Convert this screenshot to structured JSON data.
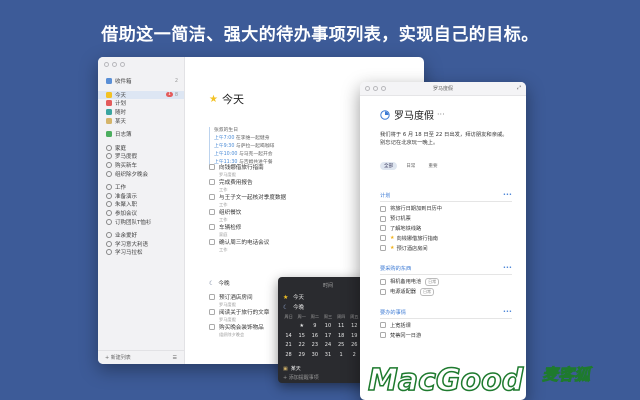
{
  "headline": "借助这一简洁、强大的待办事项列表，实现自己的目标。",
  "main_window": {
    "sidebar": {
      "items": [
        {
          "label": "收件箱",
          "count": "2",
          "icon": "inbox-icon",
          "color": "#5a8fd6"
        },
        {
          "label": "今天",
          "badge": "1",
          "count": "8",
          "icon": "star-icon",
          "color": "#f3c224",
          "selected": true
        },
        {
          "label": "计划",
          "count": "",
          "icon": "calendar-icon",
          "color": "#e35b5b"
        },
        {
          "label": "随时",
          "count": "",
          "icon": "layers-icon",
          "color": "#3aa5a0"
        },
        {
          "label": "某天",
          "count": "",
          "icon": "archive-icon",
          "color": "#d5b56a"
        },
        {
          "label": "日志簿",
          "count": "",
          "icon": "logbook-icon",
          "color": "#4cae5f"
        }
      ],
      "groups": [
        {
          "label": "家庭",
          "projects": [
            "罗马度假",
            "购买新车",
            "组织除夕晚会"
          ]
        },
        {
          "label": "工作",
          "projects": [
            "准备演示",
            "朱聚入职",
            "参加会议",
            "订购团队T恤衫"
          ]
        },
        {
          "label": "业余爱好",
          "projects": [
            "学习意大利语",
            "学习马拉松"
          ]
        }
      ],
      "footer_new_list": "+ 新建列表",
      "footer_settings_icon": "sliders-icon"
    },
    "title": "今天",
    "events": [
      {
        "time": "",
        "text": "张叔的生日"
      },
      {
        "time": "上午7:00",
        "text": "在李维一起健身"
      },
      {
        "time": "上午9:30",
        "text": "与萨拉一起喝咖啡"
      },
      {
        "time": "上午10:00",
        "text": "与马克一起开会"
      },
      {
        "time": "上午11:30",
        "text": "与吉姆共进午餐"
      }
    ],
    "tasks": [
      {
        "text": "向钱娜借旅行指南",
        "sub": "罗马度假"
      },
      {
        "text": "完成费用报告",
        "sub": "工作"
      },
      {
        "text": "与王子文一起核对季度数据",
        "sub": "工作"
      },
      {
        "text": "组织餐饮",
        "sub": "工作"
      },
      {
        "text": "车辆检修",
        "sub": "家庭"
      },
      {
        "text": "确认周三的电话会议",
        "sub": "工作"
      }
    ],
    "evening_label": "今晚",
    "evening_tasks": [
      {
        "text": "预订酒店房间",
        "sub": "罗马度假"
      },
      {
        "text": "阅读关于旅行的文章",
        "sub": "罗马度假"
      },
      {
        "text": "购买晚会装饰物品",
        "sub": "组织除夕晚会"
      }
    ]
  },
  "popover": {
    "header": "时间",
    "option_today": "今天",
    "option_evening": "今晚",
    "weekdays": [
      "周日",
      "周一",
      "周二",
      "周三",
      "周四",
      "周五",
      "周六"
    ],
    "weeks": [
      [
        "",
        "",
        "",
        "",
        "",
        "",
        ""
      ],
      [
        "",
        "★",
        "9",
        "10",
        "11",
        "12",
        "13"
      ],
      [
        "14",
        "15",
        "16",
        "17",
        "18",
        "19",
        "20"
      ],
      [
        "21",
        "22",
        "23",
        "24",
        "25",
        "26",
        "27"
      ],
      [
        "28",
        "29",
        "30",
        "31",
        "1",
        "2",
        ">"
      ]
    ],
    "someday": "某天",
    "add_reminder": "+ 添加提醒事项"
  },
  "project_window": {
    "window_title": "罗马度假",
    "title": "罗马度假",
    "note": "我们将于 6 月 18 日至 22 日出发，拜访朋友和亲戚。别忘记在北京玩一晚上。",
    "tags": [
      "全部",
      "日常",
      "重要"
    ],
    "sections": [
      {
        "heading": "计划",
        "items": [
          {
            "text": "将旅行日期加到日历中",
            "flag": false
          },
          {
            "text": "预订机票",
            "flag": false
          },
          {
            "text": "了解地铁线路",
            "flag": false
          },
          {
            "text": "向钱娜借旅行指南",
            "flag": true
          },
          {
            "text": "预订酒店房间",
            "flag": true
          }
        ]
      },
      {
        "heading": "要采购的东西",
        "items": [
          {
            "text": "相机备用电池",
            "tag": "日常"
          },
          {
            "text": "电源适配器",
            "tag": "日常"
          }
        ]
      },
      {
        "heading": "要办的事情",
        "items": [
          {
            "text": "上宽括课"
          },
          {
            "text": "梵蒂冈一日游"
          }
        ]
      }
    ]
  },
  "watermark": "MacGood",
  "watermark_cjk": "麦客狐",
  "colors": {
    "background": "#3d5b98",
    "accent": "#3c7ad4",
    "star": "#f3c224"
  }
}
